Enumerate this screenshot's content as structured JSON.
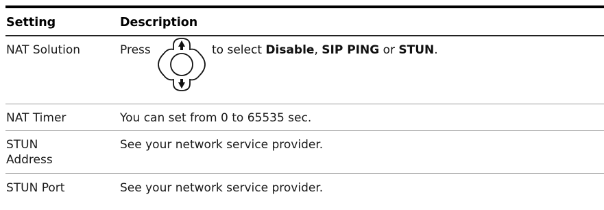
{
  "header": {
    "setting": "Setting",
    "description": "Description"
  },
  "rows": [
    {
      "setting": "NAT Solution",
      "desc_prefix": "Press",
      "desc_middle": "to select ",
      "option1": "Disable",
      "sep1": ", ",
      "option2": "SIP PING",
      "sep2": " or ",
      "option3": "STUN",
      "end": ".",
      "icon": "navigation-pad-up-down-icon"
    },
    {
      "setting": "NAT Timer",
      "description": "You can set from 0 to 65535 sec."
    },
    {
      "setting_line1": "STUN",
      "setting_line2": "Address",
      "description": "See your network service provider."
    },
    {
      "setting": "STUN Port",
      "description": "See your network service provider."
    }
  ],
  "colors": {
    "rule_top": "#000000",
    "rule_row": "#9a9a9a",
    "text": "#1a1a1a"
  }
}
